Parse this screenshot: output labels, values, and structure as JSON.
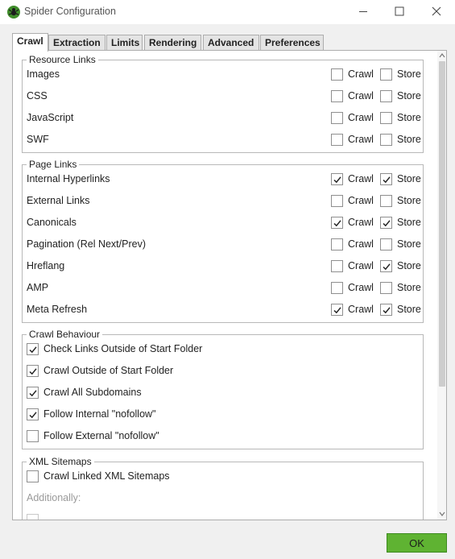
{
  "window": {
    "title": "Spider Configuration",
    "app_icon": "spider-icon",
    "controls": [
      "minimize-icon",
      "maximize-icon",
      "close-icon"
    ]
  },
  "tabs": [
    {
      "label": "Crawl",
      "active": true
    },
    {
      "label": "Extraction",
      "active": false
    },
    {
      "label": "Limits",
      "active": false
    },
    {
      "label": "Rendering",
      "active": false
    },
    {
      "label": "Advanced",
      "active": false
    },
    {
      "label": "Preferences",
      "active": false
    }
  ],
  "resource_links": {
    "title": "Resource Links",
    "crawl_label": "Crawl",
    "store_label": "Store",
    "items": [
      {
        "label": "Images",
        "crawl": false,
        "store": false
      },
      {
        "label": "CSS",
        "crawl": false,
        "store": false
      },
      {
        "label": "JavaScript",
        "crawl": false,
        "store": false
      },
      {
        "label": "SWF",
        "crawl": false,
        "store": false
      }
    ]
  },
  "page_links": {
    "title": "Page Links",
    "crawl_label": "Crawl",
    "store_label": "Store",
    "items": [
      {
        "label": "Internal Hyperlinks",
        "crawl": true,
        "store": true
      },
      {
        "label": "External Links",
        "crawl": false,
        "store": false
      },
      {
        "label": "Canonicals",
        "crawl": true,
        "store": true
      },
      {
        "label": "Pagination (Rel Next/Prev)",
        "crawl": false,
        "store": false
      },
      {
        "label": "Hreflang",
        "crawl": false,
        "store": true
      },
      {
        "label": "AMP",
        "crawl": false,
        "store": false
      },
      {
        "label": "Meta Refresh",
        "crawl": true,
        "store": true
      }
    ]
  },
  "crawl_behaviour": {
    "title": "Crawl Behaviour",
    "items": [
      {
        "label": "Check Links Outside of Start Folder",
        "checked": true
      },
      {
        "label": "Crawl Outside of Start Folder",
        "checked": true
      },
      {
        "label": "Crawl All Subdomains",
        "checked": true
      },
      {
        "label": "Follow Internal \"nofollow\"",
        "checked": true
      },
      {
        "label": "Follow External \"nofollow\"",
        "checked": false
      }
    ]
  },
  "xml_sitemaps": {
    "title": "XML Sitemaps",
    "crawl_linked": {
      "label": "Crawl Linked XML Sitemaps",
      "checked": false
    },
    "additionally_label": "Additionally:"
  },
  "footer": {
    "ok_label": "OK",
    "ok_color": "#5fb332"
  }
}
